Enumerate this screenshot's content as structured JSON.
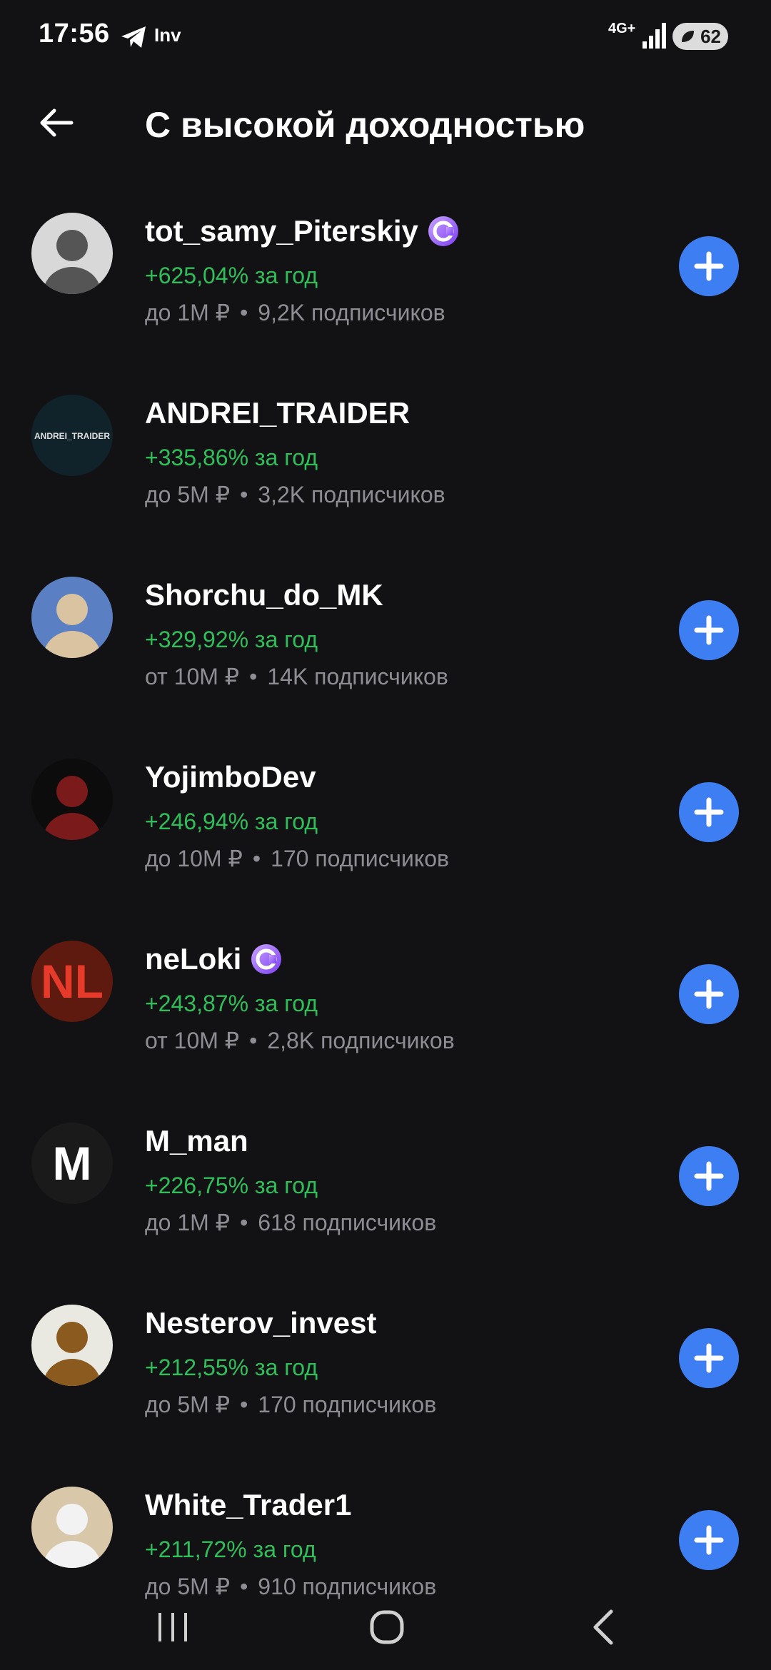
{
  "status": {
    "time": "17:56",
    "app_text": "Inv",
    "network": "4G+",
    "battery": "62"
  },
  "header": {
    "title": "С высокой доходностью"
  },
  "authors": [
    {
      "name": "tot_samy_Piterskiy",
      "verified": true,
      "yield": "+625,04% за год",
      "range": "до 1М ₽",
      "subscribers": "9,2K подписчиков",
      "follow": true,
      "avatar_bg": "#d8d8d8",
      "avatar_fg": "#555555"
    },
    {
      "name": "ANDREI_TRAIDER",
      "verified": false,
      "yield": "+335,86% за год",
      "range": "до 5М ₽",
      "subscribers": "3,2K подписчиков",
      "follow": false,
      "avatar_bg": "#10232a",
      "avatar_fg": "#e0e0e0",
      "avatar_label": "ANDREI_TRAIDER"
    },
    {
      "name": "Shorchu_do_MK",
      "verified": false,
      "yield": "+329,92% за год",
      "range": "от 10М ₽",
      "subscribers": "14K подписчиков",
      "follow": true,
      "avatar_bg": "#5a7fc2",
      "avatar_fg": "#d9c3a0"
    },
    {
      "name": "YojimboDev",
      "verified": false,
      "yield": "+246,94% за год",
      "range": "до 10М ₽",
      "subscribers": "170 подписчиков",
      "follow": true,
      "avatar_bg": "#0c0c0c",
      "avatar_fg": "#7a1a1a"
    },
    {
      "name": "neLoki",
      "verified": true,
      "yield": "+243,87% за год",
      "range": "от 10М ₽",
      "subscribers": "2,8K подписчиков",
      "follow": true,
      "avatar_bg": "#5e1a0e",
      "avatar_fg": "#e63a2a",
      "avatar_label": "NL"
    },
    {
      "name": "M_man",
      "verified": false,
      "yield": "+226,75% за год",
      "range": "до 1М ₽",
      "subscribers": "618 подписчиков",
      "follow": true,
      "avatar_bg": "#1a1a1a",
      "avatar_fg": "#ffffff",
      "avatar_label": "M"
    },
    {
      "name": "Nesterov_invest",
      "verified": false,
      "yield": "+212,55% за год",
      "range": "до 5М ₽",
      "subscribers": "170 подписчиков",
      "follow": true,
      "avatar_bg": "#e9e9e2",
      "avatar_fg": "#8a5a1e"
    },
    {
      "name": "White_Trader1",
      "verified": false,
      "yield": "+211,72% за год",
      "range": "до 5М ₽",
      "subscribers": "910 подписчиков",
      "follow": true,
      "avatar_bg": "#d9c7aa",
      "avatar_fg": "#f2f2f2"
    }
  ]
}
